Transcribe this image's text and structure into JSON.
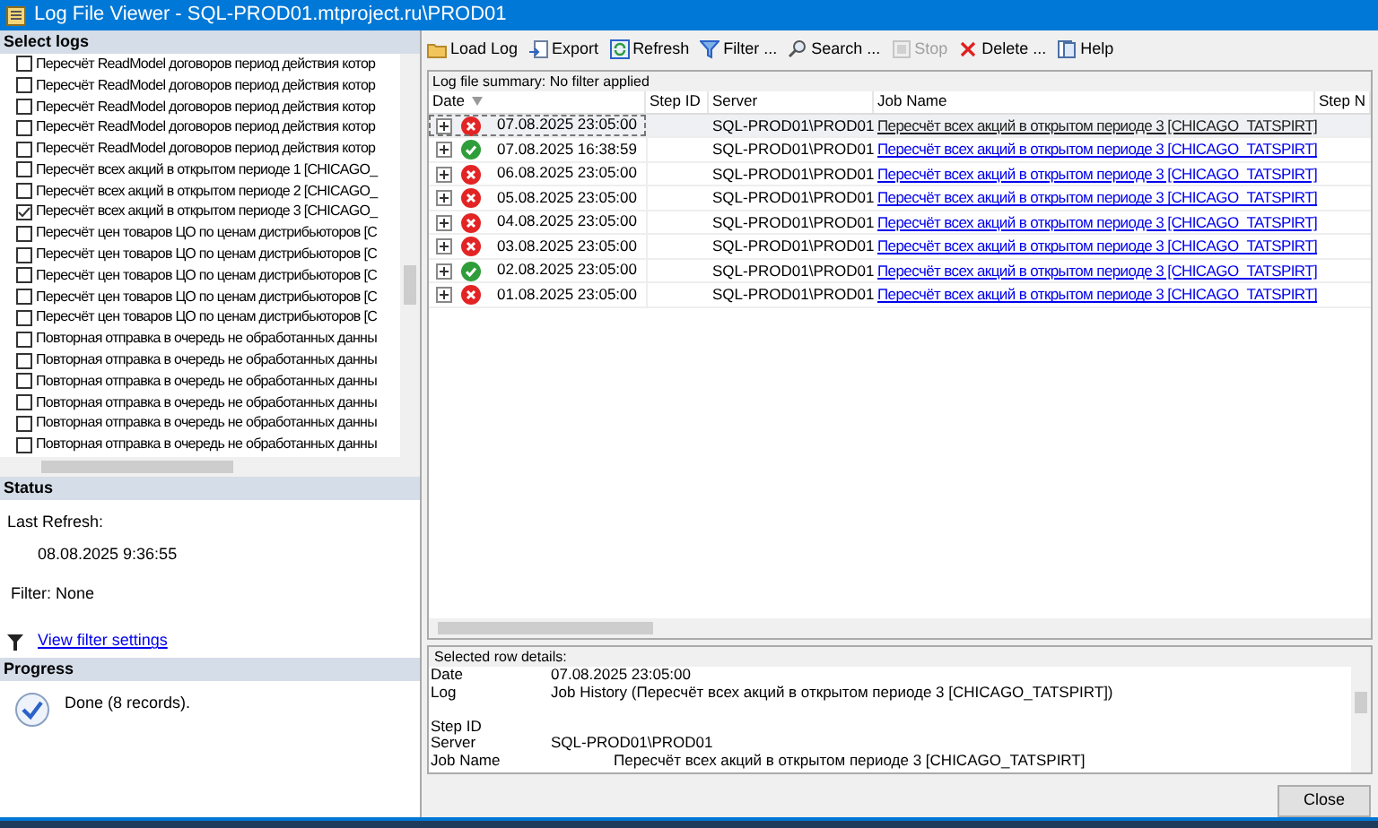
{
  "window": {
    "title": "Log File Viewer - SQL-PROD01.mtproject.ru\\PROD01"
  },
  "select_logs": {
    "title": "Select logs",
    "items": [
      {
        "label": "Пересчёт ReadModel договоров период действия котор",
        "checked": false
      },
      {
        "label": "Пересчёт ReadModel договоров период действия котор",
        "checked": false
      },
      {
        "label": "Пересчёт ReadModel договоров период действия котор",
        "checked": false
      },
      {
        "label": "Пересчёт ReadModel договоров период действия котор",
        "checked": false
      },
      {
        "label": "Пересчёт ReadModel договоров период действия котор",
        "checked": false
      },
      {
        "label": "Пересчёт всех акций в открытом периоде 1 [CHICAGO_",
        "checked": false
      },
      {
        "label": "Пересчёт всех акций в открытом периоде 2 [CHICAGO_",
        "checked": false
      },
      {
        "label": "Пересчёт всех акций в открытом периоде 3 [CHICAGO_",
        "checked": true
      },
      {
        "label": "Пересчёт цен товаров ЦО по ценам дистрибьюторов [C",
        "checked": false
      },
      {
        "label": "Пересчёт цен товаров ЦО по ценам дистрибьюторов [C",
        "checked": false
      },
      {
        "label": "Пересчёт цен товаров ЦО по ценам дистрибьюторов [C",
        "checked": false
      },
      {
        "label": "Пересчёт цен товаров ЦО по ценам дистрибьюторов [C",
        "checked": false
      },
      {
        "label": "Пересчёт цен товаров ЦО по ценам дистрибьюторов [C",
        "checked": false
      },
      {
        "label": "Повторная отправка в очередь не обработанных данны",
        "checked": false
      },
      {
        "label": "Повторная отправка в очередь не обработанных данны",
        "checked": false
      },
      {
        "label": "Повторная отправка в очередь не обработанных данны",
        "checked": false
      },
      {
        "label": "Повторная отправка в очередь не обработанных данны",
        "checked": false
      },
      {
        "label": "Повторная отправка в очередь не обработанных данны",
        "checked": false
      },
      {
        "label": "Повторная отправка в очередь не обработанных данны",
        "checked": false
      }
    ]
  },
  "status": {
    "title": "Status",
    "last_refresh_label": "Last Refresh:",
    "last_refresh": "08.08.2025 9:36:55",
    "filter": "Filter: None",
    "filter_link": "View filter settings"
  },
  "progress": {
    "title": "Progress",
    "message": "Done (8 records)."
  },
  "toolbar": [
    {
      "kind": "folder",
      "label": "Load Log",
      "disabled": false
    },
    {
      "kind": "export",
      "label": "Export",
      "disabled": false
    },
    {
      "kind": "refresh",
      "label": "Refresh",
      "disabled": false
    },
    {
      "kind": "filter",
      "label": "Filter ...",
      "disabled": false
    },
    {
      "kind": "search",
      "label": "Search ...",
      "disabled": false
    },
    {
      "kind": "stop",
      "label": "Stop",
      "disabled": true
    },
    {
      "kind": "delete",
      "label": "Delete ...",
      "disabled": false
    },
    {
      "kind": "help",
      "label": "Help",
      "disabled": false
    }
  ],
  "summary": "Log file summary: No filter applied",
  "table": {
    "columns": [
      "Date",
      "Step ID",
      "Server",
      "Job Name",
      "Step N"
    ],
    "rows": [
      {
        "kind": "error",
        "date": "07.08.2025 23:05:00",
        "server": "SQL-PROD01\\PROD01",
        "job_name": "Пересчёт всех акций в открытом периоде 3 [CHICAGO_TATSPIRT]",
        "selected": true
      },
      {
        "kind": "success",
        "date": "07.08.2025 16:38:59",
        "server": "SQL-PROD01\\PROD01",
        "job_name": "Пересчёт всех акций в открытом периоде 3 [CHICAGO_TATSPIRT]",
        "selected": false
      },
      {
        "kind": "error",
        "date": "06.08.2025 23:05:00",
        "server": "SQL-PROD01\\PROD01",
        "job_name": "Пересчёт всех акций в открытом периоде 3 [CHICAGO_TATSPIRT]",
        "selected": false
      },
      {
        "kind": "error",
        "date": "05.08.2025 23:05:00",
        "server": "SQL-PROD01\\PROD01",
        "job_name": "Пересчёт всех акций в открытом периоде 3 [CHICAGO_TATSPIRT]",
        "selected": false
      },
      {
        "kind": "error",
        "date": "04.08.2025 23:05:00",
        "server": "SQL-PROD01\\PROD01",
        "job_name": "Пересчёт всех акций в открытом периоде 3 [CHICAGO_TATSPIRT]",
        "selected": false
      },
      {
        "kind": "error",
        "date": "03.08.2025 23:05:00",
        "server": "SQL-PROD01\\PROD01",
        "job_name": "Пересчёт всех акций в открытом периоде 3 [CHICAGO_TATSPIRT]",
        "selected": false
      },
      {
        "kind": "success",
        "date": "02.08.2025 23:05:00",
        "server": "SQL-PROD01\\PROD01",
        "job_name": "Пересчёт всех акций в открытом периоде 3 [CHICAGO_TATSPIRT]",
        "selected": false
      },
      {
        "kind": "error",
        "date": "01.08.2025 23:05:00",
        "server": "SQL-PROD01\\PROD01",
        "job_name": "Пересчёт всех акций в открытом периоде 3 [CHICAGO_TATSPIRT]",
        "selected": false
      }
    ]
  },
  "details": {
    "title": "Selected row details:",
    "fields": [
      {
        "label": "Date",
        "value": "07.08.2025 23:05:00",
        "indented": false
      },
      {
        "label": "Log",
        "value": "Job History (Пересчёт всех акций в открытом периоде 3 [CHICAGO_TATSPIRT])",
        "indented": false
      },
      {
        "label": "Step ID"
      },
      {
        "label": "Server",
        "value": "SQL-PROD01\\PROD01",
        "indented": false
      },
      {
        "label": "Job Name",
        "value": "Пересчёт всех акций в открытом периоде 3 [CHICAGO_TATSPIRT]",
        "indented": true
      }
    ]
  },
  "close_button": "Close"
}
